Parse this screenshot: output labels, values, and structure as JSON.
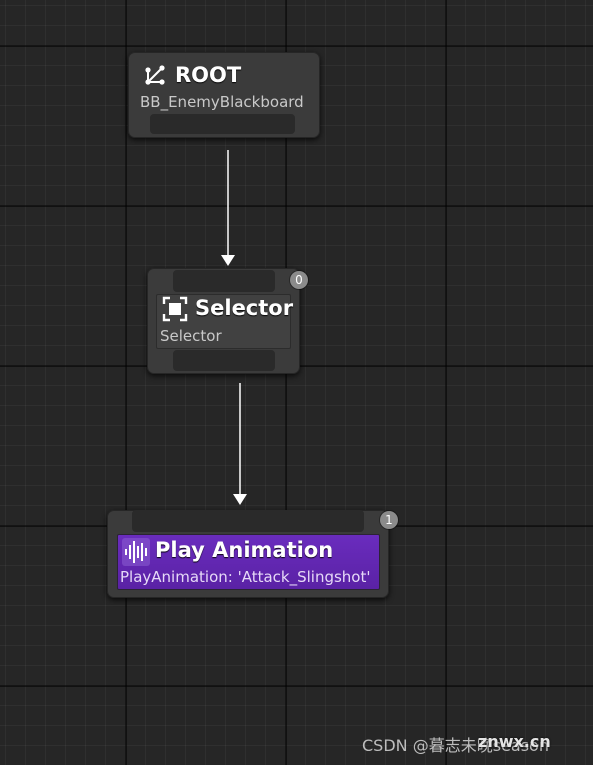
{
  "graph": {
    "nodes": {
      "root": {
        "title": "ROOT",
        "subtitle": "BB_EnemyBlackboard",
        "icon": "tree-root-icon"
      },
      "selector": {
        "title": "Selector",
        "subtitle": "Selector",
        "icon": "selector-icon",
        "execution_index": "0"
      },
      "play_animation": {
        "title": "Play Animation",
        "subtitle": "PlayAnimation: 'Attack_Slingshot'",
        "icon": "animation-waveform-icon",
        "execution_index": "1",
        "color": "#5e24aa"
      }
    },
    "connections": [
      {
        "from": "ROOT",
        "to": "Selector"
      },
      {
        "from": "Selector",
        "to": "Play Animation"
      }
    ]
  },
  "colors": {
    "background": "#262626",
    "node_body": "#3b3b3b",
    "task_node_accent": "#6a2cbe",
    "wire": "#ffffff"
  },
  "watermark": {
    "text": "CSDN @暮志未晚season",
    "brand": "znwx.cn"
  }
}
